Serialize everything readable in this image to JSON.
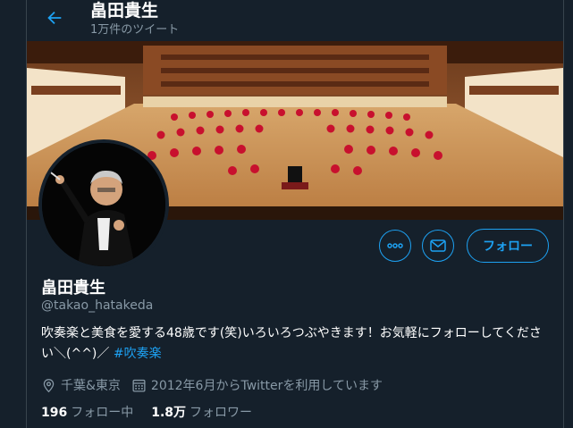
{
  "header": {
    "name": "畠田貴生",
    "tweet_count": "1万件のツイート"
  },
  "profile": {
    "name": "畠田貴生",
    "handle": "@takao_hatakeda",
    "bio_text": "吹奏楽と美食を愛する48歳です(笑)いろいろつぶやきます！お気軽にフォローしてください＼(^^)／",
    "bio_hashtag": "#吹奏楽",
    "location": "千葉&東京",
    "joined": "2012年6月からTwitterを利用しています"
  },
  "actions": {
    "follow_label": "フォロー"
  },
  "stats": {
    "following_count": "196",
    "following_label": "フォロー中",
    "followers_count": "1.8万",
    "followers_label": "フォロワー"
  },
  "colors": {
    "background": "#15202b",
    "accent": "#1da1f2",
    "secondary_text": "#8899a6",
    "border": "#38444d"
  },
  "icons": [
    "back-arrow-icon",
    "more-dots-icon",
    "mail-icon",
    "location-pin-icon",
    "calendar-icon"
  ]
}
